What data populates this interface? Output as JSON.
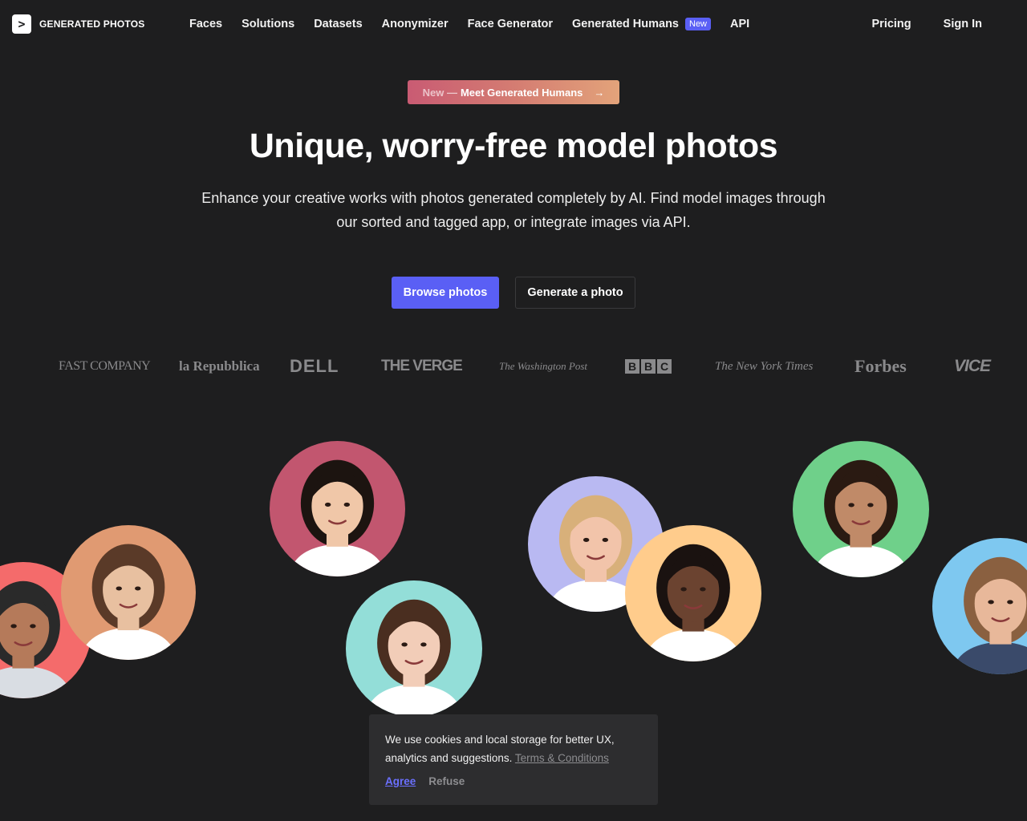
{
  "header": {
    "logo_mark": ">",
    "logo_text": "GENERATED PHOTOS",
    "nav": [
      {
        "label": "Faces"
      },
      {
        "label": "Solutions"
      },
      {
        "label": "Datasets"
      },
      {
        "label": "Anonymizer"
      },
      {
        "label": "Face Generator"
      },
      {
        "label": "Generated Humans",
        "badge": "New"
      },
      {
        "label": "API"
      }
    ],
    "pricing": "Pricing",
    "sign_in": "Sign In"
  },
  "hero": {
    "announcement_prefix": "New —",
    "announcement_text": "Meet Generated Humans",
    "announcement_arrow": "→",
    "title": "Unique, worry-free model photos",
    "subtitle": "Enhance your creative works with photos generated completely by AI. Find model images through our sorted and tagged app, or integrate images via API.",
    "primary_button": "Browse photos",
    "secondary_button": "Generate a photo"
  },
  "press": {
    "fastco": "FAST COMPANY",
    "repubblica": "la Repubblica",
    "dell": "DELL",
    "verge": "THE VERGE",
    "wapo": "The Washington Post",
    "bbc": [
      "B",
      "B",
      "C"
    ],
    "nyt": "The New York Times",
    "forbes": "Forbes",
    "vice": "VICE"
  },
  "faces": [
    {
      "name": "middle-aged-man",
      "bg": "#f46b6b",
      "skin": "#b57a5a",
      "hair": "#2a2a2a",
      "shirt": "#d9dde3"
    },
    {
      "name": "toddler-boy",
      "bg": "#e09a72",
      "skin": "#e8c0a0",
      "hair": "#5a3a28",
      "shirt": "#ffffff"
    },
    {
      "name": "asian-woman",
      "bg": "#c2566f",
      "skin": "#f0c7a8",
      "hair": "#1c1410",
      "shirt": "#ffffff"
    },
    {
      "name": "young-woman",
      "bg": "#93ded8",
      "skin": "#f2cdb8",
      "hair": "#4a2e20",
      "shirt": "#ffffff"
    },
    {
      "name": "blonde-girl",
      "bg": "#b9b9f2",
      "skin": "#f2c4aa",
      "hair": "#d8b07a",
      "shirt": "#ffffff"
    },
    {
      "name": "young-black-man",
      "bg": "#ffcc8c",
      "skin": "#6b4330",
      "hair": "#1a1210",
      "shirt": "#ffffff"
    },
    {
      "name": "girl-dark-hair",
      "bg": "#6fd08a",
      "skin": "#c08a68",
      "hair": "#2a1a12",
      "shirt": "#ffffff"
    },
    {
      "name": "smiling-man",
      "bg": "#7ec8f0",
      "skin": "#e8b89a",
      "hair": "#8a6040",
      "shirt": "#3a4a6a"
    }
  ],
  "cookie": {
    "text": "We use cookies and local storage for better UX, analytics and suggestions.",
    "link": "Terms & Conditions",
    "agree": "Agree",
    "refuse": "Refuse"
  }
}
